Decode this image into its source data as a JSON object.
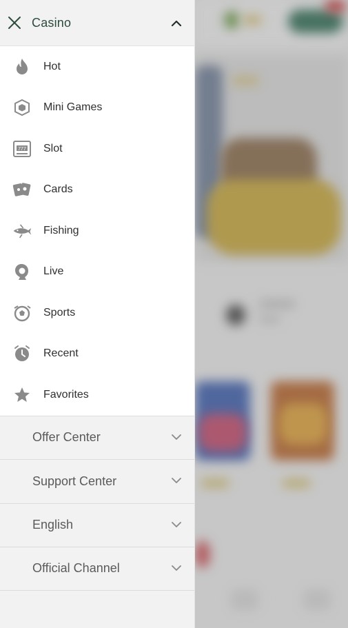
{
  "drawer": {
    "title": "Casino",
    "menu": [
      {
        "label": "Hot",
        "icon": "flame-icon"
      },
      {
        "label": "Mini Games",
        "icon": "cube-icon"
      },
      {
        "label": "Slot",
        "icon": "slot-machine-icon"
      },
      {
        "label": "Cards",
        "icon": "cards-icon"
      },
      {
        "label": "Fishing",
        "icon": "fish-icon"
      },
      {
        "label": "Live",
        "icon": "dealer-icon"
      },
      {
        "label": "Sports",
        "icon": "soccer-ball-icon"
      },
      {
        "label": "Recent",
        "icon": "clock-icon"
      },
      {
        "label": "Favorites",
        "icon": "star-icon"
      }
    ],
    "sections": [
      {
        "label": "Offer Center"
      },
      {
        "label": "Support Center"
      },
      {
        "label": "English"
      },
      {
        "label": "Official Channel"
      }
    ]
  },
  "colors": {
    "title_text": "#2d4b3d",
    "icon_gray": "#8a8a8a",
    "drawer_bg": "#f2f2f2",
    "menu_bg": "#ffffff"
  }
}
